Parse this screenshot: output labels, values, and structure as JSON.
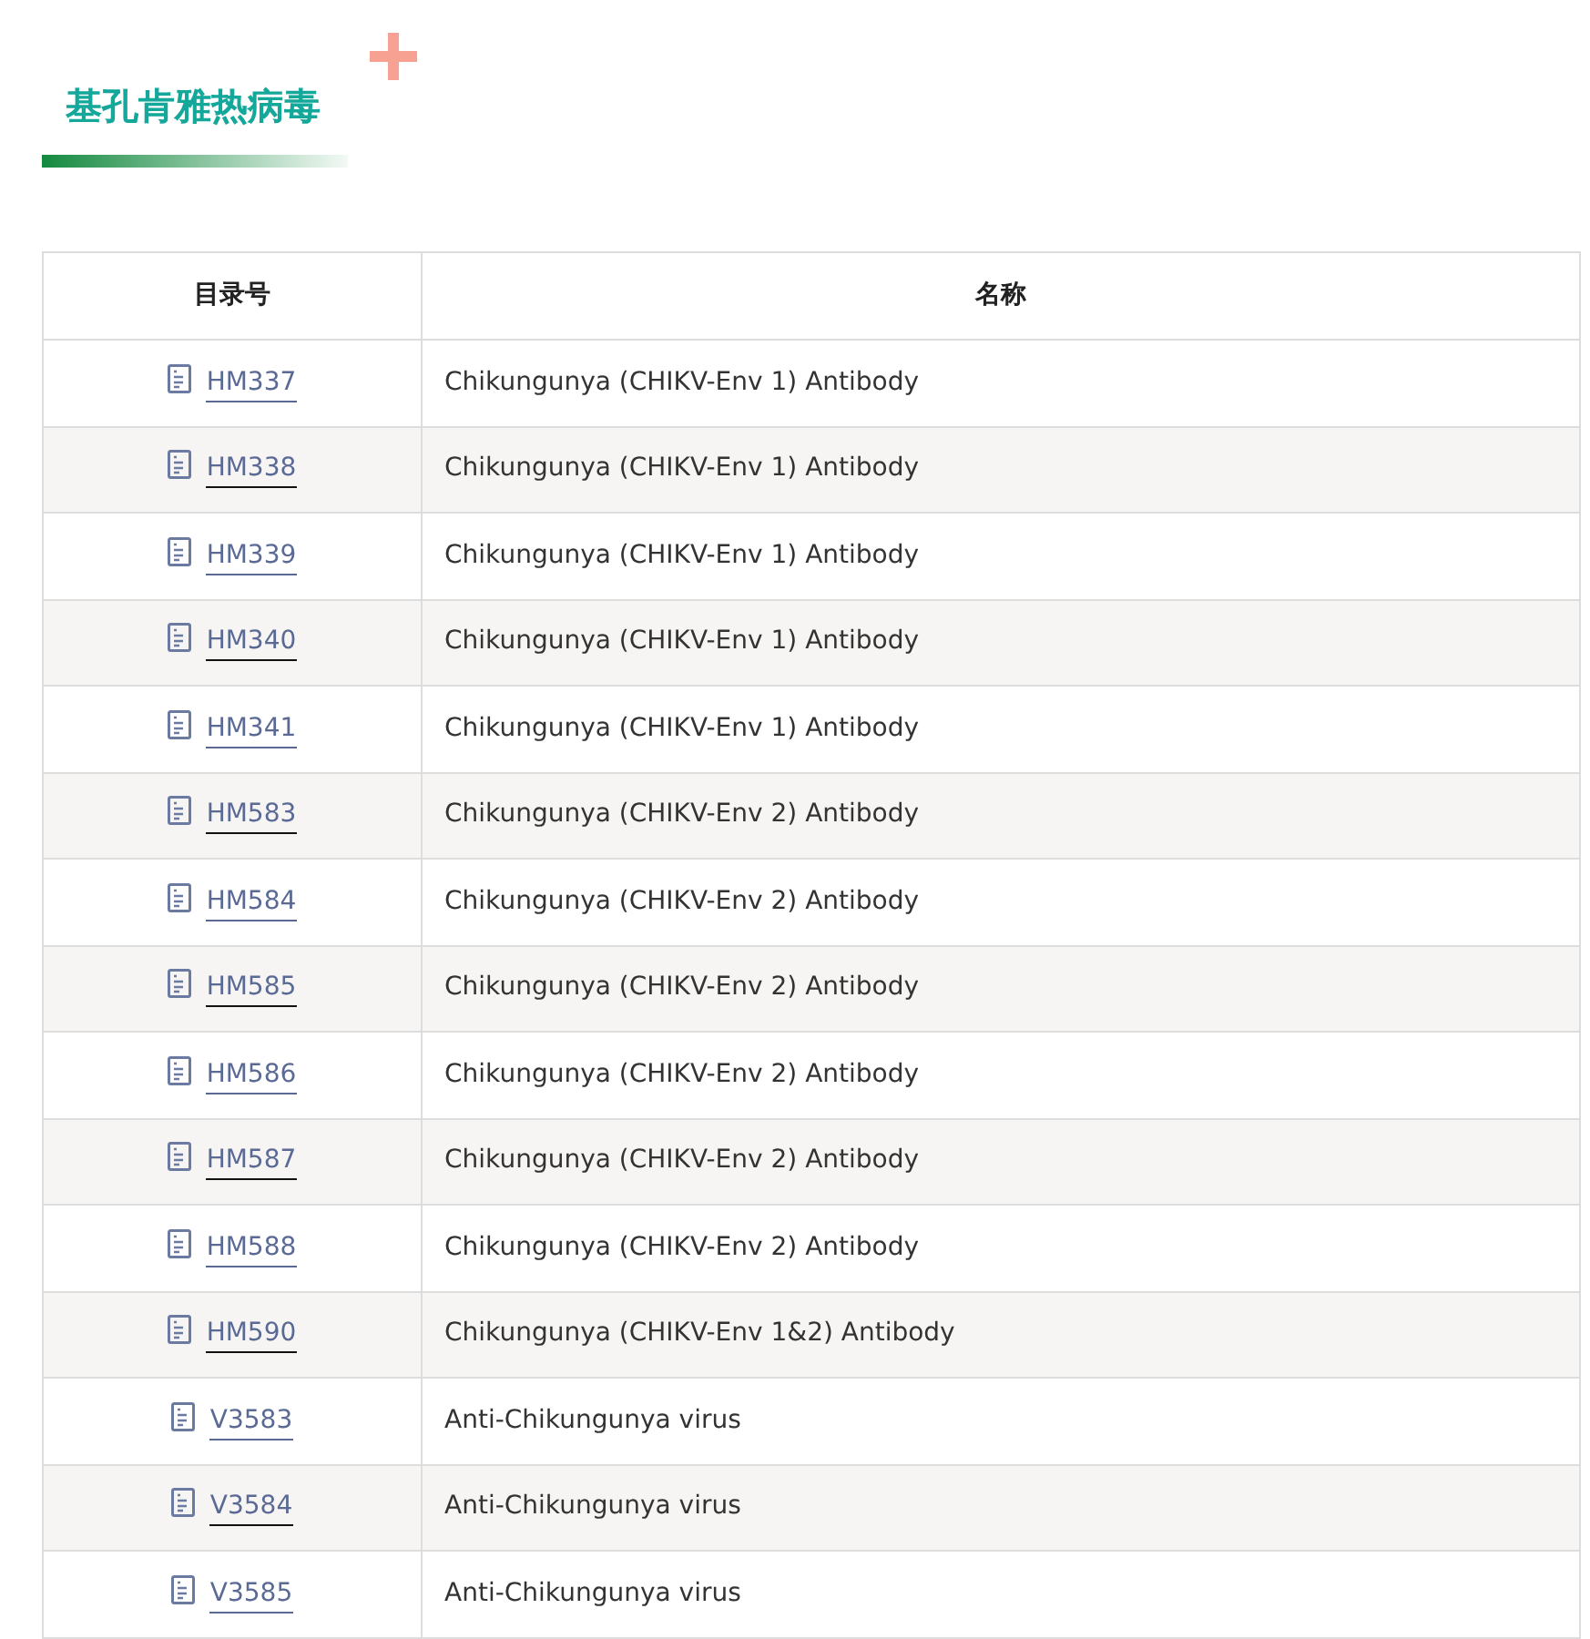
{
  "title": "基孔肯雅热病毒",
  "table": {
    "columns": [
      "目录号",
      "名称"
    ],
    "rows": [
      {
        "catalog": "HM337",
        "name": "Chikungunya (CHIKV-Env 1) Antibody"
      },
      {
        "catalog": "HM338",
        "name": "Chikungunya (CHIKV-Env 1) Antibody"
      },
      {
        "catalog": "HM339",
        "name": "Chikungunya (CHIKV-Env 1) Antibody"
      },
      {
        "catalog": "HM340",
        "name": "Chikungunya (CHIKV-Env 1) Antibody"
      },
      {
        "catalog": "HM341",
        "name": "Chikungunya (CHIKV-Env 1) Antibody"
      },
      {
        "catalog": "HM583",
        "name": "Chikungunya (CHIKV-Env 2) Antibody"
      },
      {
        "catalog": "HM584",
        "name": "Chikungunya (CHIKV-Env 2) Antibody"
      },
      {
        "catalog": "HM585",
        "name": "Chikungunya (CHIKV-Env 2) Antibody"
      },
      {
        "catalog": "HM586",
        "name": "Chikungunya (CHIKV-Env 2) Antibody"
      },
      {
        "catalog": "HM587",
        "name": "Chikungunya (CHIKV-Env 2) Antibody"
      },
      {
        "catalog": "HM588",
        "name": "Chikungunya (CHIKV-Env 2) Antibody"
      },
      {
        "catalog": "HM590",
        "name": "Chikungunya (CHIKV-Env 1&2) Antibody"
      },
      {
        "catalog": "V3583",
        "name": "Anti-Chikungunya virus"
      },
      {
        "catalog": "V3584",
        "name": "Anti-Chikungunya virus"
      },
      {
        "catalog": "V3585",
        "name": "Anti-Chikungunya virus"
      }
    ]
  }
}
